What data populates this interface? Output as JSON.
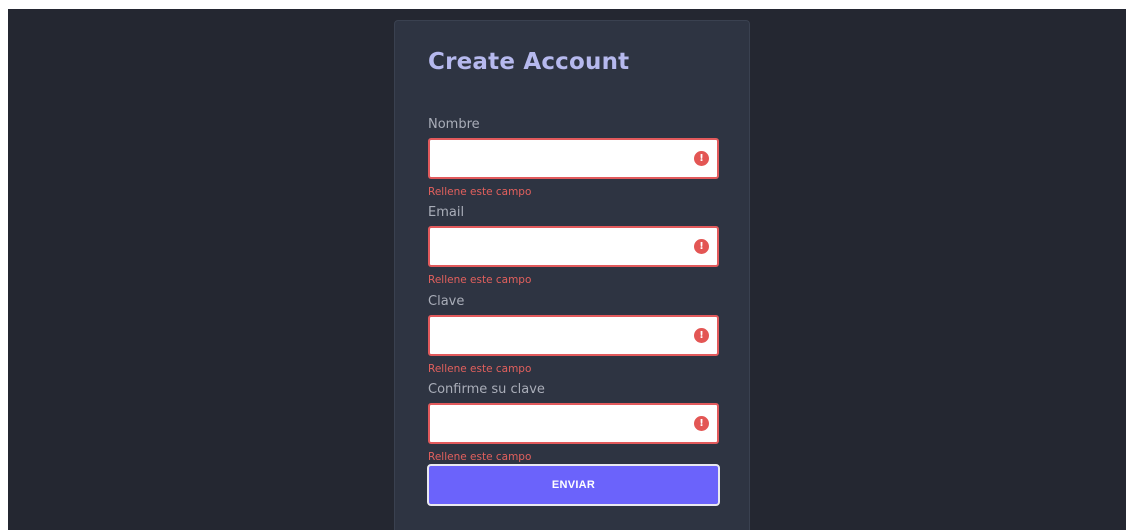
{
  "form": {
    "title": "Create Account",
    "fields": [
      {
        "label": "Nombre",
        "value": "",
        "placeholder": "",
        "error": "Rellene este campo",
        "icon": "error-icon"
      },
      {
        "label": "Email",
        "value": "",
        "placeholder": "",
        "error": "Rellene este campo",
        "icon": "error-icon"
      },
      {
        "label": "Clave",
        "value": "",
        "placeholder": "",
        "error": "Rellene este campo",
        "icon": "error-icon"
      },
      {
        "label": "Confirme su clave",
        "value": "",
        "placeholder": "",
        "error": "Rellene este campo",
        "icon": "error-icon"
      }
    ],
    "error_icon_glyph": "!",
    "submit_label": "ENVIAR"
  },
  "colors": {
    "page_background": "#242731",
    "card_background": "#2e3442",
    "title": "#b6b9ee",
    "error": "#e25a5c",
    "submit_button": "#6b63fb"
  }
}
